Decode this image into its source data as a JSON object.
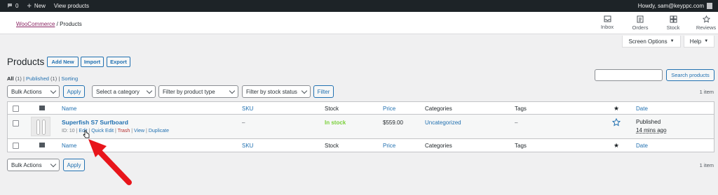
{
  "adminbar": {
    "comments_count": "0",
    "new_label": "New",
    "view_products": "View products",
    "howdy": "Howdy, sam@keyppc.com"
  },
  "breadcrumb": {
    "parent": "WooCommerce",
    "separator": "/",
    "current": "Products"
  },
  "header_actions": [
    {
      "label": "Inbox",
      "icon": "inbox-icon"
    },
    {
      "label": "Orders",
      "icon": "orders-icon"
    },
    {
      "label": "Stock",
      "icon": "stock-icon"
    },
    {
      "label": "Reviews",
      "icon": "reviews-icon"
    }
  ],
  "screen_options": "Screen Options",
  "help": "Help",
  "page": {
    "title": "Products",
    "add_new": "Add New",
    "import": "Import",
    "export": "Export"
  },
  "views": {
    "all": "All",
    "all_count": "(1)",
    "published": "Published",
    "published_count": "(1)",
    "sorting": "Sorting",
    "sep": "|"
  },
  "search": {
    "button": "Search products",
    "value": ""
  },
  "filters": {
    "bulk_actions": "Bulk Actions",
    "apply": "Apply",
    "category": "Select a category",
    "product_type": "Filter by product type",
    "stock_status": "Filter by stock status",
    "filter": "Filter"
  },
  "items_count": "1 item",
  "columns": {
    "name": "Name",
    "sku": "SKU",
    "stock": "Stock",
    "price": "Price",
    "categories": "Categories",
    "tags": "Tags",
    "featured": "★",
    "date": "Date"
  },
  "product": {
    "name": "Superfish S7 Surfboard",
    "id_label": "ID: 10",
    "edit": "Edit",
    "quick_edit": "Quick Edit",
    "trash": "Trash",
    "view": "View",
    "duplicate": "Duplicate",
    "sku": "–",
    "stock": "In stock",
    "price": "$559.00",
    "category": "Uncategorized",
    "tags": "–",
    "date_status": "Published",
    "date_ago": "14 mins ago"
  },
  "colors": {
    "accent": "#2271b1",
    "woo": "#8a2563",
    "instock": "#7ad03a",
    "arrow": "#e8151b"
  }
}
